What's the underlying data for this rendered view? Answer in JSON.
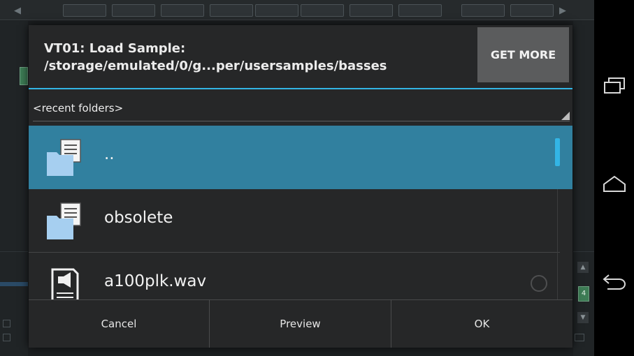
{
  "dialog": {
    "title_line1": "VT01: Load Sample:",
    "title_line2": "/storage/emulated/0/g...per/usersamples/basses",
    "get_more_label": "GET MORE",
    "recent_folders_label": "<recent folders>",
    "files": [
      {
        "label": "..",
        "type": "folder",
        "selected": true
      },
      {
        "label": "obsolete",
        "type": "folder",
        "selected": false
      },
      {
        "label": "a100plk.wav",
        "type": "audio-file",
        "selected": false
      }
    ],
    "buttons": {
      "cancel": "Cancel",
      "preview": "Preview",
      "ok": "OK"
    }
  },
  "background": {
    "channel_number": "4"
  },
  "navbar": {
    "icons": [
      "recent-apps-icon",
      "home-icon",
      "back-icon"
    ]
  },
  "colors": {
    "accent": "#33b5e5",
    "selected_row": "#31809f",
    "dialog_bg": "#262728",
    "get_more_bg": "#5b5c5d",
    "folder_icon": "#a6cff0"
  }
}
